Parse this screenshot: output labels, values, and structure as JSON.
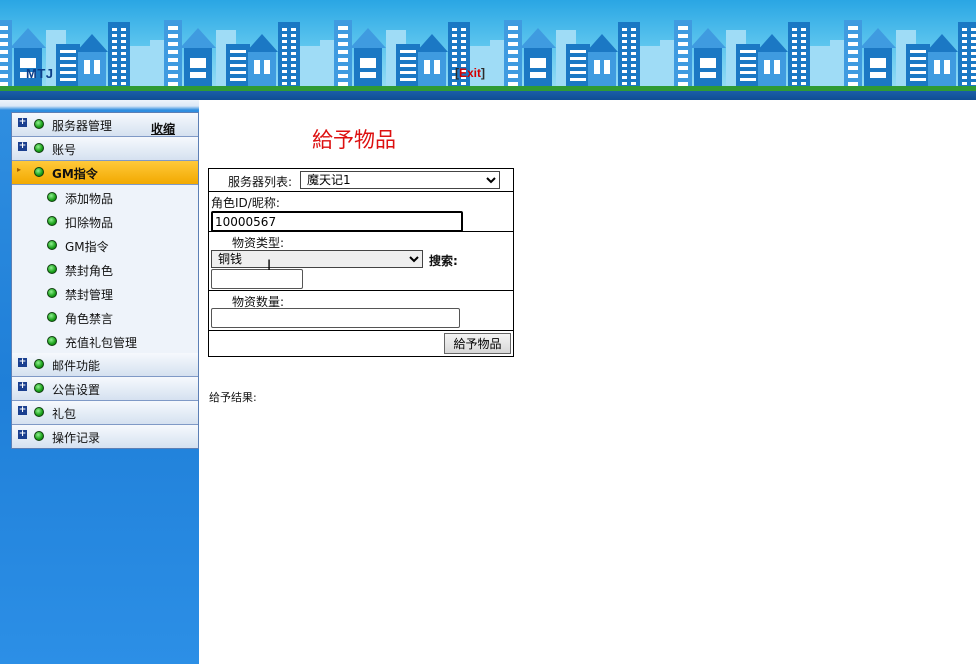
{
  "header": {
    "brand": "MTJ",
    "exit_label": "Exit",
    "bracket_open": "[",
    "bracket_close": "]",
    "colors": {
      "sky": "#2aa6e4",
      "building": "#1b78c4",
      "ground": "#2f9a35",
      "band": "#1a5ea8"
    }
  },
  "sidebar": {
    "collapse_label": "收缩",
    "categories": [
      {
        "label": "服务器管理",
        "icon": "plus-icon",
        "expanded": false
      },
      {
        "label": "账号",
        "icon": "plus-icon",
        "expanded": false
      },
      {
        "label": "GM指令",
        "icon": "arrow-icon",
        "expanded": true,
        "active": true,
        "items": [
          "添加物品",
          "扣除物品",
          "GM指令",
          "禁封角色",
          "禁封管理",
          "角色禁言",
          "充值礼包管理"
        ]
      },
      {
        "label": "邮件功能",
        "icon": "plus-icon",
        "expanded": false
      },
      {
        "label": "公告设置",
        "icon": "plus-icon",
        "expanded": false
      },
      {
        "label": "礼包",
        "icon": "plus-icon",
        "expanded": false
      },
      {
        "label": "操作记录",
        "icon": "plus-icon",
        "expanded": false
      }
    ],
    "colors": {
      "active": "#f2a900",
      "panel": "#1f7fd8"
    }
  },
  "main": {
    "title": "給予物品",
    "title_color": "#dd1010",
    "form": {
      "server_label": "服务器列表:",
      "server_selected": "魔天记1",
      "role_label": "角色ID/昵称:",
      "role_value": "10000567",
      "type_label": "物资类型:",
      "type_selected": "铜钱",
      "search_label": "搜索:",
      "search_value": "",
      "qty_label": "物资数量:",
      "qty_value": "",
      "submit_label": "給予物品"
    },
    "result_label": "给予结果:"
  }
}
